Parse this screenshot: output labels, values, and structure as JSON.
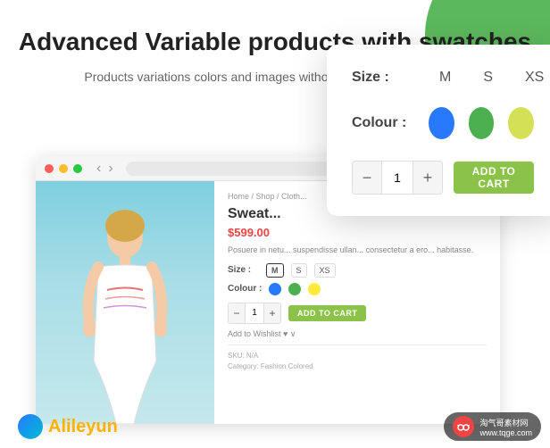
{
  "page": {
    "title": "Advanced Variable products with swatches",
    "subtitle": "Products variations colors and images without any additional plugins."
  },
  "browser": {
    "url": ""
  },
  "product": {
    "breadcrumb": "Home / Shop / Cloth...",
    "name": "Sweat...",
    "price": "$599.00",
    "description": "Posuere in netu... suspendisse ullan... consectetur a ero... habitasse.",
    "size_label": "Size :",
    "sizes": [
      "M",
      "S",
      "XS"
    ],
    "colour_label": "Colour :",
    "colours": [
      "blue",
      "green",
      "yellow"
    ],
    "quantity": "1",
    "add_to_cart": "ADD TO CART",
    "wishlist": "Add to Wishlist",
    "sku": "N/A",
    "category": "Fashion Colored"
  },
  "popup": {
    "size_label": "Size :",
    "sizes": [
      "M",
      "S",
      "XS"
    ],
    "colour_label": "Colour :",
    "quantity": "1",
    "add_to_cart_label": "ADD TO CART"
  },
  "branding": {
    "name_part1": "Alile",
    "name_highlight": "y",
    "name_part2": "un"
  },
  "watermark": {
    "url": "www.tqge.com",
    "text": "淘气哥素材网",
    "subtext": "www.tqge.com"
  },
  "icons": {
    "minus": "−",
    "plus": "+",
    "back_arrow": "‹",
    "forward_arrow": "›"
  }
}
